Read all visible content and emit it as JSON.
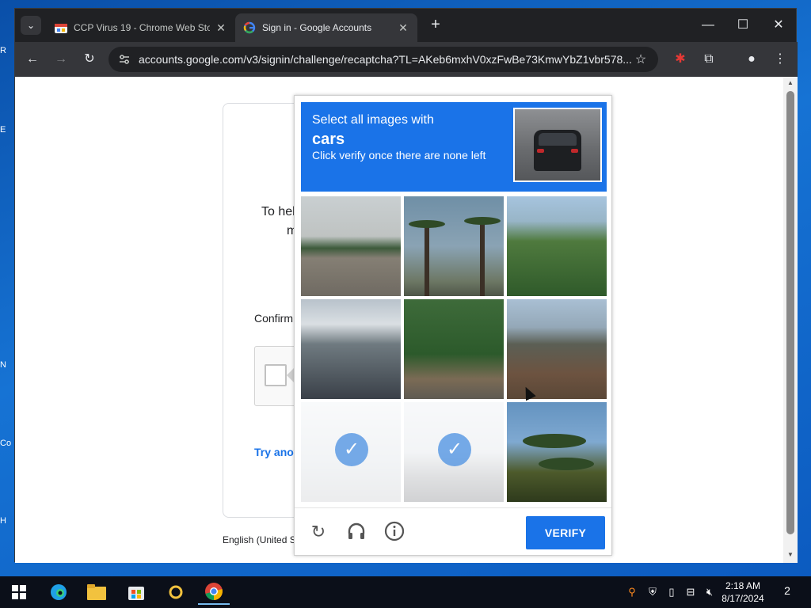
{
  "browser": {
    "tabs": [
      {
        "title": "CCP Virus 19 - Chrome Web Sto",
        "close": "✕"
      },
      {
        "title": "Sign in - Google Accounts",
        "close": "✕"
      }
    ],
    "new_tab": "+",
    "url": "accounts.google.com/v3/signin/challenge/recaptcha?TL=AKeb6mxhV0xzFwBe73KmwYbZ1vbr578...",
    "window_controls": {
      "minimize": "—",
      "maximize": "☐",
      "close": "✕"
    }
  },
  "google_page": {
    "heading_fragment_1": "To hel",
    "heading_fragment_2": "m",
    "confirm_fragment": "Confirm",
    "try_another": "Try anot",
    "footer_language": "English (United S"
  },
  "recaptcha": {
    "instruction_line1": "Select all images with",
    "target": "cars",
    "instruction_line3": "Click verify once there are none left",
    "tiles_selected": [
      false,
      false,
      false,
      false,
      false,
      false,
      true,
      true,
      false
    ],
    "verify_label": "VERIFY",
    "reload_icon": "reload-icon",
    "audio_icon": "headphones-icon",
    "info_icon": "info-icon"
  },
  "taskbar": {
    "time": "2:18 AM",
    "date": "8/17/2024",
    "notification_count": "2"
  },
  "desktop_icon_labels": [
    "R",
    "E",
    "N",
    "Co",
    "H"
  ],
  "colors": {
    "accent": "#1a73e8",
    "chrome_dark": "#202124",
    "chrome_toolbar": "#35363a"
  }
}
